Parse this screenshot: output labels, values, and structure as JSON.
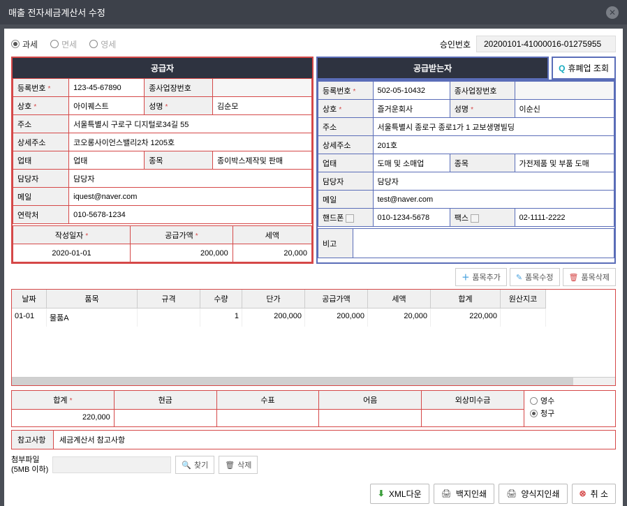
{
  "title": "매출 전자세금계산서 수정",
  "tax_types": {
    "taxable": "과세",
    "exempt": "면세",
    "zero": "영세"
  },
  "approval": {
    "label": "승인번호",
    "value": "20200101-41000016-01275955"
  },
  "lookup_btn": "휴폐업 조회",
  "supplier": {
    "header": "공급자",
    "reg_no_label": "등록번호",
    "reg_no": "123-45-67890",
    "sub_biz_label": "종사업장번호",
    "sub_biz": "",
    "company_label": "상호",
    "company": "아이퀘스트",
    "ceo_label": "성명",
    "ceo": "김순모",
    "addr_label": "주소",
    "addr": "서울특별시 구로구 디지털로34길 55",
    "addr2_label": "상세주소",
    "addr2": "코오롱사이언스밸리2차 1205호",
    "biztype_label": "업태",
    "biztype": "업태",
    "bizkind_label": "종목",
    "bizkind": "종이박스제작및 판매",
    "manager_label": "담당자",
    "manager": "담당자",
    "email_label": "메일",
    "email": "iquest@naver.com",
    "phone_label": "연락처",
    "phone": "010-5678-1234"
  },
  "buyer": {
    "header": "공급받는자",
    "reg_no_label": "등록번호",
    "reg_no": "502-05-10432",
    "sub_biz_label": "종사업장번호",
    "sub_biz": "",
    "company_label": "상호",
    "company": "즐거운회사",
    "ceo_label": "성명",
    "ceo": "이순신",
    "addr_label": "주소",
    "addr": "서울특별시 종로구 종로1가 1 교보생명빌딩",
    "addr2_label": "상세주소",
    "addr2": "201호",
    "biztype_label": "업태",
    "biztype": "도매 및 소매업",
    "bizkind_label": "종목",
    "bizkind": "가전제품 및 부품 도매",
    "manager_label": "담당자",
    "manager": "담당자",
    "email_label": "메일",
    "email": "test@naver.com",
    "mobile_label": "핸드폰",
    "mobile": "010-1234-5678",
    "fax_label": "팩스",
    "fax": "02-1111-2222"
  },
  "summary": {
    "write_date_label": "작성일자",
    "write_date": "2020-01-01",
    "supply_amt_label": "공급가액",
    "supply_amt": "200,000",
    "tax_label": "세액",
    "tax": "20,000",
    "remark_label": "비고",
    "remark": ""
  },
  "item_btns": {
    "add": "품목추가",
    "edit": "품목수정",
    "del": "품목삭제"
  },
  "grid": {
    "cols": {
      "date": "날짜",
      "item": "품목",
      "spec": "규격",
      "qty": "수량",
      "price": "단가",
      "supply": "공급가액",
      "tax": "세액",
      "total": "합계",
      "origin": "원산지코"
    },
    "rows": [
      {
        "date": "01-01",
        "item": "물품A",
        "spec": "",
        "qty": "1",
        "price": "200,000",
        "supply": "200,000",
        "tax": "20,000",
        "total": "220,000",
        "origin": ""
      }
    ]
  },
  "totals": {
    "sum_label": "합계",
    "sum": "220,000",
    "cash_label": "현금",
    "cash": "",
    "check_label": "수표",
    "check": "",
    "note_label": "어음",
    "note": "",
    "credit_label": "외상미수금",
    "credit": "",
    "receipt": "영수",
    "claim": "청구"
  },
  "notes": {
    "label": "참고사항",
    "value": "세금계산서 참고사항"
  },
  "attach": {
    "label": "첨부파일",
    "sub": "(5MB 이하)",
    "find": "찾기",
    "del": "삭제"
  },
  "footer": {
    "xml": "XML다운",
    "blank_print": "백지인쇄",
    "form_print": "양식지인쇄",
    "cancel": "취 소"
  }
}
